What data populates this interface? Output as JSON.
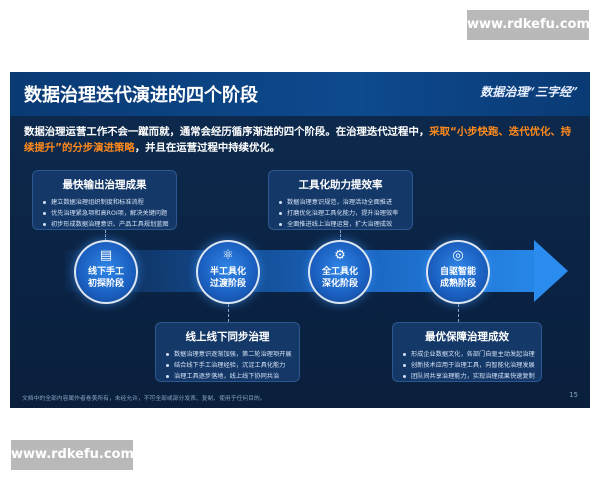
{
  "watermarks": {
    "top": "www.rdkefu.com",
    "bottom": "www.rdkefu.com"
  },
  "slide": {
    "title": "数据治理迭代演进的四个阶段",
    "badge": "数据治理“三字经”",
    "intro": {
      "part1": "数据治理运营工作不会一蹴而就，通常会经历循序渐进的四个阶段。在治理迭代过程中，",
      "highlight": "采取“小步快跑、迭代优化、持续提升”的分步演进策略",
      "part2": "，并且在运营过程中持续优化。"
    },
    "cards": {
      "c1": {
        "title": "最快输出治理成果",
        "items": [
          "建立数据治理组织制度和标准流程",
          "优先治理紧急项和高ROI项，解决关键问题",
          "初步形成数据治理意识、产品工具规划蓝图"
        ]
      },
      "c2": {
        "title": "线上线下同步治理",
        "items": [
          "数据治理意识逐渐加强，第二轮治理项开展",
          "结合线下手工治理经验，沉淀工具化能力",
          "治理工具逐步落地，线上线下协同共治"
        ]
      },
      "c3": {
        "title": "工具化助力提效率",
        "items": [
          "数据治理意识规范，治理活动全面推进",
          "打磨优化治理工具化能力，提升治理效率",
          "全面推进线上治理运营，扩大治理成效"
        ]
      },
      "c4": {
        "title": "最优保障治理成效",
        "items": [
          "形成企业数据文化，各部门自驱主动发起治理",
          "创新技术应用于治理工具，向智能化治理发展",
          "团队间共享治理能力，实现治理成果快速复制"
        ]
      }
    },
    "nodes": {
      "n1": {
        "icon": "▤",
        "line1": "线下手工",
        "line2": "初探阶段"
      },
      "n2": {
        "icon": "⚛",
        "line1": "半工具化",
        "line2": "过渡阶段"
      },
      "n3": {
        "icon": "⚙",
        "line1": "全工具化",
        "line2": "深化阶段"
      },
      "n4": {
        "icon": "◎",
        "line1": "自驱智能",
        "line2": "成熟阶段"
      }
    },
    "footnote": "文档中的全部内容属作者卷美所有，未经允许，不可全部或部分发表、复制、使用于任何目的。",
    "page_number": "15"
  }
}
